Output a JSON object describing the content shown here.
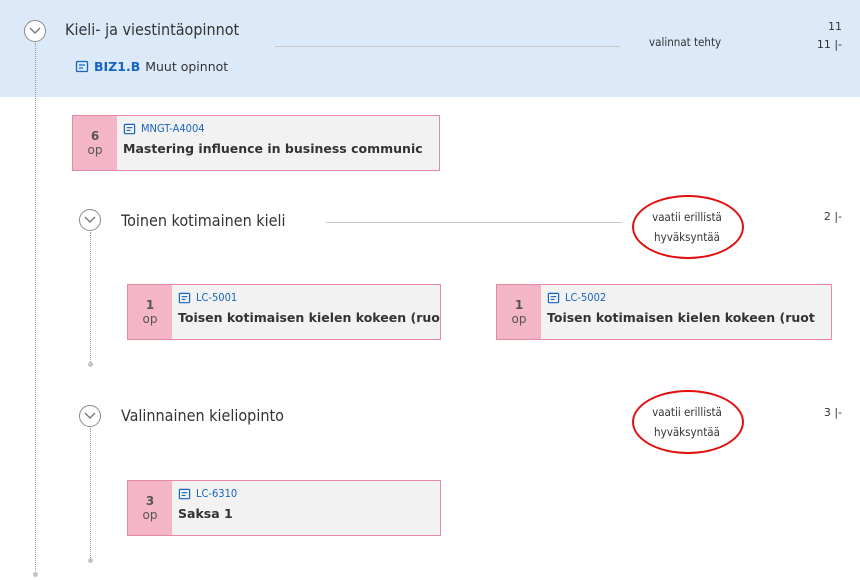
{
  "group": {
    "title": "Kieli- ja viestintäopinnot",
    "status": "valinnat tehty",
    "count_top": "11",
    "count_range": "11 |-",
    "module_code": "BIZ1.B",
    "module_name": "Muut opinnot"
  },
  "main_course": {
    "credits": "6",
    "unit": "op",
    "code": "MNGT-A4004",
    "name": "Mastering influence in business communic"
  },
  "subgroups": [
    {
      "title": "Toinen kotimainen kieli",
      "note_line1": "vaatii erillistä",
      "note_line2": "hyväksyntää",
      "range": "2 |-",
      "courses": [
        {
          "credits": "1",
          "unit": "op",
          "code": "LC-5001",
          "name": "Toisen kotimaisen kielen kokeen (ruot"
        },
        {
          "credits": "1",
          "unit": "op",
          "code": "LC-5002",
          "name": "Toisen kotimaisen kielen kokeen (ruot"
        }
      ]
    },
    {
      "title": "Valinnainen kieliopinto",
      "note_line1": "vaatii erillistä",
      "note_line2": "hyväksyntää",
      "range": "3 |-",
      "courses": [
        {
          "credits": "3",
          "unit": "op",
          "code": "LC-6310",
          "name": "Saksa 1"
        }
      ]
    }
  ],
  "colors": {
    "header_bg": "#dbe9f8",
    "code_blue": "#1565c0",
    "credit_pink": "#f4b6c6",
    "highlight_red": "#e01010"
  }
}
